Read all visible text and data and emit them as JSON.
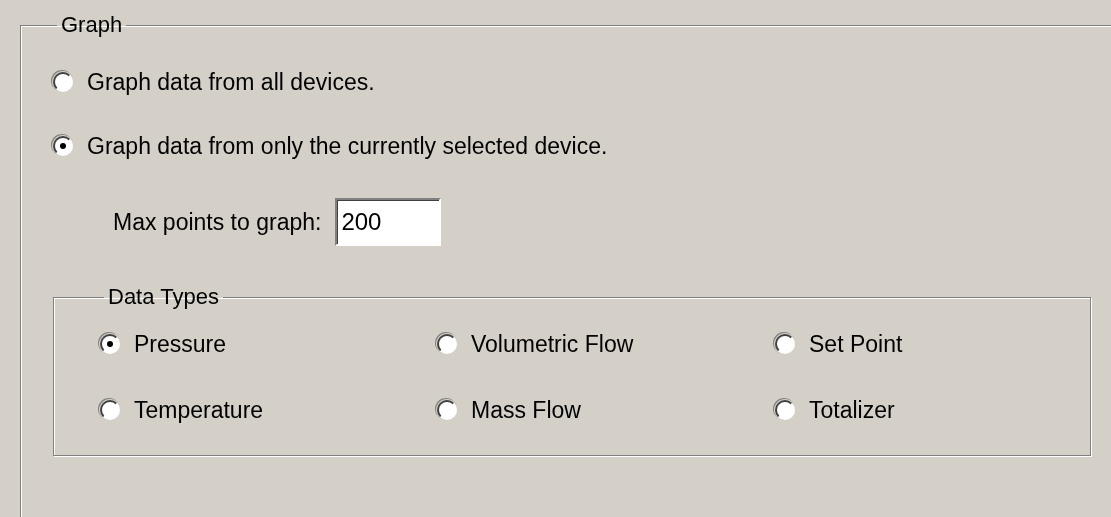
{
  "graph": {
    "title": "Graph",
    "options": [
      {
        "label": "Graph data from all devices.",
        "selected": false
      },
      {
        "label": "Graph data from only the currently selected device.",
        "selected": true
      }
    ],
    "max_points": {
      "label": "Max points to graph:",
      "value": "200"
    },
    "data_types": {
      "title": "Data Types",
      "options": [
        {
          "label": "Pressure",
          "selected": true
        },
        {
          "label": "Volumetric Flow",
          "selected": false
        },
        {
          "label": "Set Point",
          "selected": false
        },
        {
          "label": "Temperature",
          "selected": false
        },
        {
          "label": "Mass Flow",
          "selected": false
        },
        {
          "label": "Totalizer",
          "selected": false
        }
      ]
    }
  }
}
